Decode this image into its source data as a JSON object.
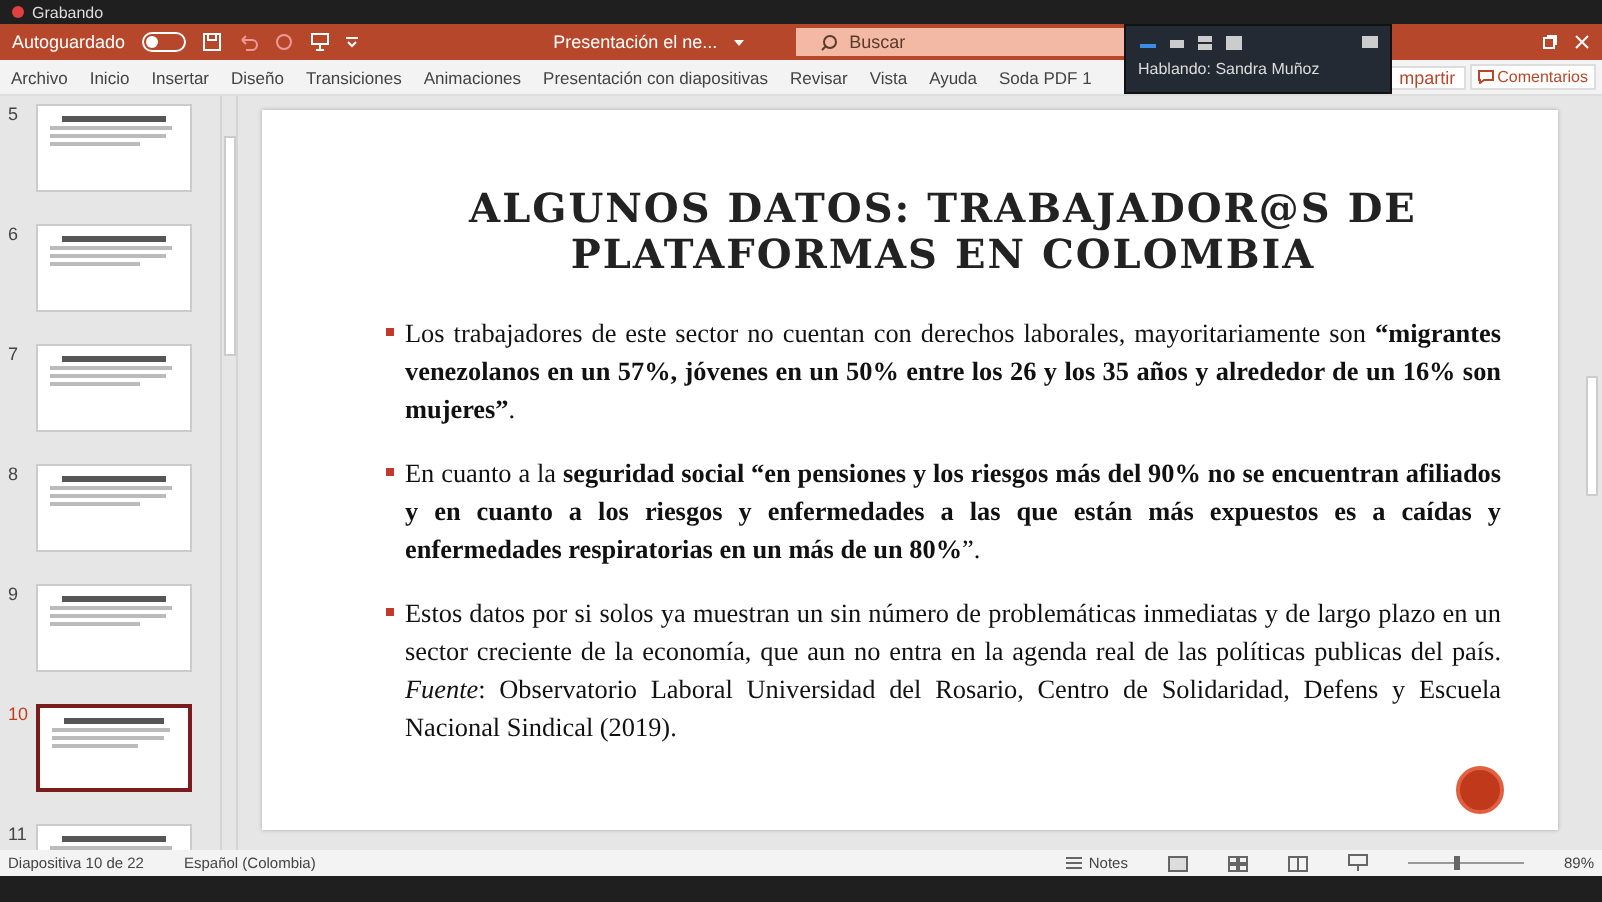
{
  "recording": {
    "label": "Grabando"
  },
  "title_bar": {
    "autosave_label": "Autoguardado",
    "autosave_on": false,
    "document_title": "Presentación el ne...",
    "search_placeholder": "Buscar"
  },
  "ribbon_tabs": [
    {
      "label": "Archivo"
    },
    {
      "label": "Inicio"
    },
    {
      "label": "Insertar"
    },
    {
      "label": "Diseño"
    },
    {
      "label": "Transiciones"
    },
    {
      "label": "Animaciones"
    },
    {
      "label": "Presentación con diapositivas"
    },
    {
      "label": "Revisar"
    },
    {
      "label": "Vista"
    },
    {
      "label": "Ayuda"
    },
    {
      "label": "Soda PDF 1"
    }
  ],
  "share_button": "mpartir",
  "comments_button": "Comentarios",
  "meeting_popup": {
    "speaker": "Hablando: Sandra Muñoz"
  },
  "slides": [
    {
      "number": "5",
      "selected": false
    },
    {
      "number": "6",
      "selected": false
    },
    {
      "number": "7",
      "selected": false
    },
    {
      "number": "8",
      "selected": false
    },
    {
      "number": "9",
      "selected": false
    },
    {
      "number": "10",
      "selected": true
    },
    {
      "number": "11",
      "selected": false
    }
  ],
  "slide": {
    "title": "ALGUNOS DATOS: TRABAJADOR@S DE PLATAFORMAS EN COLOMBIA",
    "bullets": [
      "Los trabajadores de este sector no cuentan con derechos laborales, mayoritariamente son **“migrantes venezolanos en un 57%, jóvenes en un 50% entre los 26 y los 35 años y alrededor de un 16% son mujeres”**.",
      "En cuanto a la **seguridad social “en pensiones y los riesgos más del 90% no se encuentran afiliados y en cuanto a los riesgos y enfermedades a las que están más expuestos es a caídas y enfermedades respiratorias en un más de un 80%**”.",
      "Estos datos por si solos ya muestran un sin número de problemáticas inmediatas y de largo plazo en un sector creciente de la economía, que aun no entra en la agenda real de las políticas publicas del país. *Fuente*: Observatorio Laboral Universidad del Rosario, Centro de Solidaridad, Defens y Escuela Nacional Sindical (2019)."
    ]
  },
  "status_bar": {
    "slide_count": "Diapositiva 10 de 22",
    "language": "Español (Colombia)",
    "notes": "Notes",
    "level": 0.4,
    "zoom": "89%"
  }
}
